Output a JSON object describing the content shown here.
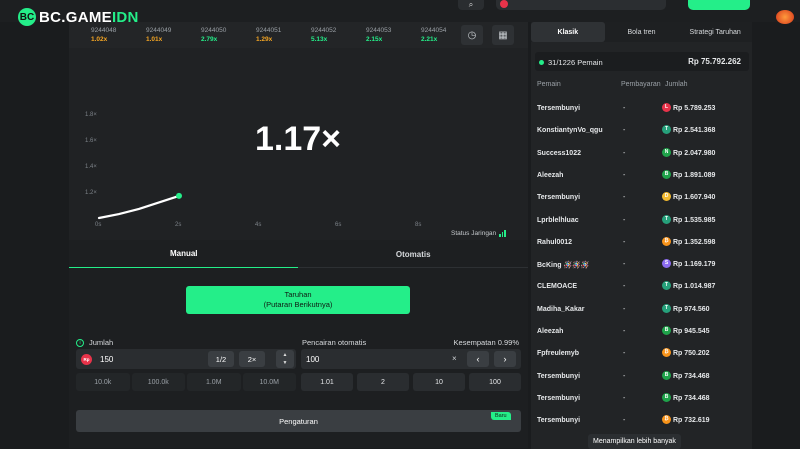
{
  "header": {
    "logo_mark": "BC",
    "logo_text_main": "BC.GAME",
    "logo_text_accent": "IDN"
  },
  "history": [
    {
      "id": "9244048",
      "value": "1.02x",
      "color": "#f5a623"
    },
    {
      "id": "9244049",
      "value": "1.01x",
      "color": "#f5a623"
    },
    {
      "id": "9244050",
      "value": "2.79x",
      "color": "#24ee89"
    },
    {
      "id": "9244051",
      "value": "1.29x",
      "color": "#f5a623"
    },
    {
      "id": "9244052",
      "value": "5.13x",
      "color": "#24ee89"
    },
    {
      "id": "9244053",
      "value": "2.15x",
      "color": "#24ee89"
    },
    {
      "id": "9244054",
      "value": "2.21x",
      "color": "#24ee89"
    }
  ],
  "history_buttons": {
    "clock_glyph": "◷",
    "grid_glyph": "▦"
  },
  "chart": {
    "multiplier": "1.17×",
    "y_ticks": [
      "1.8×",
      "1.6×",
      "1.4×",
      "1.2×"
    ],
    "x_ticks": [
      "0s",
      "2s",
      "4s",
      "6s",
      "8s"
    ],
    "network_status": "Status Jaringan"
  },
  "chart_data": {
    "type": "line",
    "x": [
      0,
      0.5,
      1,
      1.5,
      2
    ],
    "y": [
      1.0,
      1.03,
      1.07,
      1.12,
      1.17
    ],
    "xlim": [
      0,
      8
    ],
    "ylim": [
      1.0,
      2.0
    ],
    "color": "#ffffff",
    "end_point_color": "#24ee89"
  },
  "bet_tabs": {
    "manual": "Manual",
    "auto": "Otomatis"
  },
  "bet_button": {
    "line1": "Taruhan",
    "line2": "(Putaran Berikutnya)"
  },
  "amount": {
    "label": "Jumlah",
    "currency": "Rp",
    "value": "150",
    "half": "1/2",
    "double": "2×",
    "presets": [
      "10.0k",
      "100.0k",
      "1.0M",
      "10.0M"
    ]
  },
  "auto_cashout": {
    "label": "Pencairan otomatis",
    "chance_label": "Kesempatan 0.99%",
    "value": "100",
    "clear": "×",
    "prev": "‹",
    "next": "›",
    "presets": [
      "1.01",
      "2",
      "10",
      "100"
    ]
  },
  "settings": {
    "label": "Pengaturan",
    "badge": "Baru"
  },
  "footer": {
    "likes": "237997"
  },
  "side": {
    "tabs": [
      "Klasik",
      "Bola tren",
      "Strategi Taruhan"
    ],
    "players_count": "31/1226 Pemain",
    "total": "Rp 75.792.262",
    "header_player": "Pemain",
    "header_payout": "Pembayaran",
    "header_amount": "Jumlah",
    "players": [
      {
        "name": "Tersembunyi",
        "payout": "-",
        "amount": "Rp 5.789.253",
        "coin": "#e8334a",
        "coin_letter": "L"
      },
      {
        "name": "KonstiantynVo_qgu",
        "payout": "-",
        "amount": "Rp 2.541.368",
        "coin": "#26a17b",
        "coin_letter": "T"
      },
      {
        "name": "Success1022",
        "payout": "-",
        "amount": "Rp 2.047.980",
        "coin": "#1fa34a",
        "coin_letter": "N"
      },
      {
        "name": "Aleezah",
        "payout": "-",
        "amount": "Rp 1.891.089",
        "coin": "#1fa34a",
        "coin_letter": "B"
      },
      {
        "name": "Tersembunyi",
        "payout": "-",
        "amount": "Rp 1.607.940",
        "coin": "#f3ba2f",
        "coin_letter": "D"
      },
      {
        "name": "Lprblelhluac",
        "payout": "-",
        "amount": "Rp 1.535.985",
        "coin": "#26a17b",
        "coin_letter": "T"
      },
      {
        "name": "Rahul0012",
        "payout": "-",
        "amount": "Rp 1.352.598",
        "coin": "#f7931a",
        "coin_letter": "₿"
      },
      {
        "name": "BcKing 🪅🪅🪅",
        "payout": "-",
        "amount": "Rp 1.169.179",
        "coin": "#8c6cf0",
        "coin_letter": "S"
      },
      {
        "name": "CLEMOACE",
        "payout": "-",
        "amount": "Rp 1.014.987",
        "coin": "#26a17b",
        "coin_letter": "T"
      },
      {
        "name": "Madiha_Kakar",
        "payout": "-",
        "amount": "Rp 974.560",
        "coin": "#26a17b",
        "coin_letter": "T"
      },
      {
        "name": "Aleezah",
        "payout": "-",
        "amount": "Rp 945.545",
        "coin": "#1fa34a",
        "coin_letter": "B"
      },
      {
        "name": "Fpfreulemyb",
        "payout": "-",
        "amount": "Rp 750.202",
        "coin": "#f7931a",
        "coin_letter": "₿"
      },
      {
        "name": "Tersembunyi",
        "payout": "-",
        "amount": "Rp 734.468",
        "coin": "#1fa34a",
        "coin_letter": "B"
      },
      {
        "name": "Tersembunyi",
        "payout": "-",
        "amount": "Rp 734.468",
        "coin": "#1fa34a",
        "coin_letter": "B"
      },
      {
        "name": "Tersembunyi",
        "payout": "-",
        "amount": "Rp 732.619",
        "coin": "#f7931a",
        "coin_letter": "₿"
      }
    ],
    "show_more": "Menampilkan lebih banyak"
  }
}
